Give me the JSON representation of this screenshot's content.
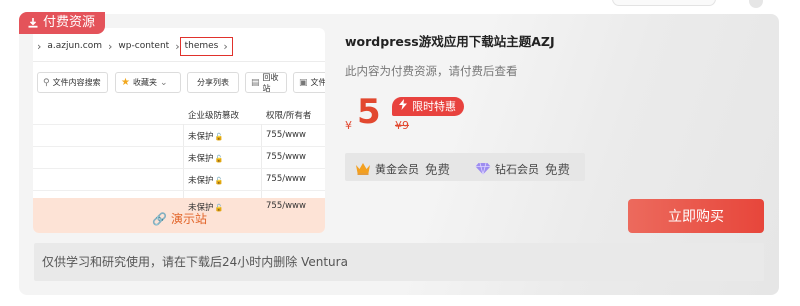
{
  "badge": {
    "label": "付费资源"
  },
  "preview": {
    "breadcrumbs": [
      "a.azjun.com",
      "wp-content",
      "themes"
    ],
    "toolbar": [
      "文件内容搜索",
      "收藏夹",
      "分享列表",
      "回收站",
      "文件"
    ],
    "headers": [
      "企业级防篡改",
      "权限/所有者"
    ],
    "rows": [
      {
        "status": "未保护",
        "perm": "755/www"
      },
      {
        "status": "未保护",
        "perm": "755/www"
      },
      {
        "status": "未保护",
        "perm": "755/www"
      },
      {
        "status": "未保护",
        "perm": "755/www"
      }
    ],
    "demo_link": "演示站"
  },
  "product": {
    "title": "wordpress游戏应用下载站主题AZJ",
    "subtitle": "此内容为付费资源，请付费后查看",
    "currency": "¥",
    "price": "5",
    "promo": "限时特惠",
    "original_price": "¥9"
  },
  "members": [
    {
      "name": "黄金会员",
      "price": "免费",
      "icon": "crown-icon"
    },
    {
      "name": "钻石会员",
      "price": "免费",
      "icon": "diamond-icon"
    }
  ],
  "buy_button": "立即购买",
  "notice": "仅供学习和研究使用，请在下载后24小时内删除 Ventura",
  "colors": {
    "accent": "#e7463b",
    "badge": "#e4535a",
    "demo_link": "#e2652a"
  }
}
